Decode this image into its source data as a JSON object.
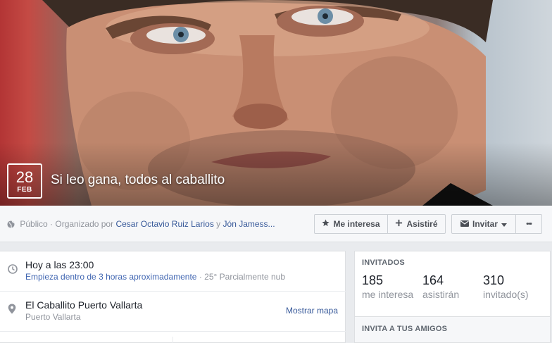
{
  "event": {
    "day": "28",
    "month": "FEB",
    "title": "Si leo gana, todos al caballito"
  },
  "meta": {
    "privacy": "Público",
    "organized_prefix": "· Organizado por",
    "organizer_1": "Cesar Octavio Ruiz Larios",
    "joiner": "y",
    "organizer_2": "Jón Jamess..."
  },
  "actions": {
    "interested_label": "Me interesa",
    "going_label": "Asistiré",
    "invite_label": "Invitar",
    "more_label": "•••"
  },
  "details": {
    "time_title": "Hoy a las 23:00",
    "time_relative": "Empieza dentro de 3 horas aproximadamente",
    "weather": "· 25° Parcialmente nub",
    "place_title": "El Caballito Puerto Vallarta",
    "place_city": "Puerto Vallarta",
    "map_link": "Mostrar mapa"
  },
  "guests": {
    "heading": "INVITADOS",
    "interested_count": "185",
    "interested_label": "me interesa",
    "going_count": "164",
    "going_label": "asistirán",
    "invited_count": "310",
    "invited_label": "invitado(s)"
  },
  "invite_friends": {
    "heading": "INVITA A TUS AMIGOS"
  },
  "colors": {
    "link": "#365899",
    "accent_link": "#4267b2",
    "muted": "#90949c",
    "background": "#e9ebee"
  },
  "icons": [
    "globe-icon",
    "star-icon",
    "plus-icon",
    "envelope-icon",
    "caret-down-icon",
    "clock-icon",
    "location-pin-icon"
  ]
}
